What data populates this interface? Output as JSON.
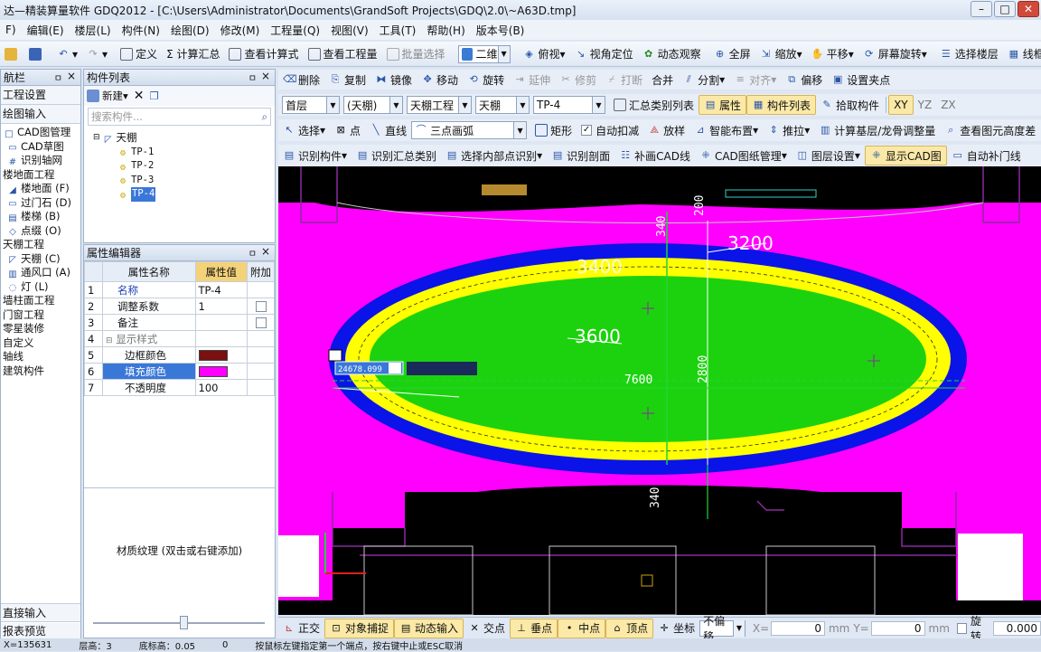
{
  "title": "达—精装算量软件 GDQ2012 - [C:\\Users\\Administrator\\Documents\\GrandSoft Projects\\GDQ\\2.0\\~A63D.tmp]",
  "menu": [
    "F)",
    "编辑(E)",
    "楼层(L)",
    "构件(N)",
    "绘图(D)",
    "修改(M)",
    "工程量(Q)",
    "视图(V)",
    "工具(T)",
    "帮助(H)",
    "版本号(B)"
  ],
  "toolbar1": {
    "define": "定义",
    "sum": "Σ 计算汇总",
    "view_formula": "查看计算式",
    "view_qty": "查看工程量",
    "batch_select": "批量选择",
    "view_2d": "二维",
    "top_view": "俯视",
    "view_locate": "视角定位",
    "dynamic_view": "动态观察",
    "fullscreen": "全屏",
    "zoom": "缩放",
    "pan": "平移",
    "screen_rotate": "屏幕旋转",
    "select_floor": "选择楼层",
    "wireframe": "线框"
  },
  "toolbar2": {
    "delete": "删除",
    "copy": "复制",
    "mirror": "镜像",
    "move": "移动",
    "rotate": "旋转",
    "extend": "延伸",
    "trim": "修剪",
    "break": "打断",
    "merge": "合并",
    "split": "分割",
    "align": "对齐",
    "offset": "偏移",
    "set_point": "设置夹点"
  },
  "toolbar3": {
    "floor": "首层",
    "type": "(天棚)",
    "project": "天棚工程",
    "element": "天棚",
    "component": "TP-4",
    "summary_list": "汇总类别列表",
    "attributes": "属性",
    "component_list": "构件列表",
    "pick": "拾取构件",
    "xy": "XY",
    "yz": "YZ",
    "zx": "ZX"
  },
  "toolbar4": {
    "select": "选择",
    "point": "点",
    "line": "直线",
    "arc": "三点画弧",
    "rect": "矩形",
    "auto_deduct": "自动扣减",
    "place_sample": "放样",
    "smart_place": "智能布置",
    "push_pull": "推拉",
    "calc_base": "计算基层/龙骨调整量",
    "view_height": "查看图元高度差"
  },
  "toolbar5": {
    "identify_component": "识别构件",
    "identify_summary": "识别汇总类别",
    "identify_inner": "选择内部点识别",
    "identify_section": "识别剖面",
    "fill_cad": "补画CAD线",
    "cad_manage": "CAD图纸管理",
    "layer_setting": "图层设置",
    "show_cad": "显示CAD图",
    "auto_door": "自动补门线"
  },
  "nav": {
    "title": "航栏",
    "items": [
      "工程设置",
      "绘图输入",
      "CAD图管理",
      "CAD草图",
      "识别轴网",
      "楼地面工程",
      "楼地面 (F)",
      "过门石 (D)",
      "楼梯 (B)",
      "点缀 (O)",
      "天棚工程",
      "天棚 (C)",
      "通风口 (A)",
      "灯 (L)",
      "墙柱面工程",
      "门窗工程",
      "零星装修",
      "自定义",
      "轴线",
      "建筑构件"
    ],
    "bottom_items": [
      "直接输入",
      "报表预览"
    ]
  },
  "component_list": {
    "title": "构件列表",
    "new_label": "新建",
    "search_placeholder": "搜索构件...",
    "root": "天棚",
    "items": [
      "TP-1",
      "TP-2",
      "TP-3",
      "TP-4"
    ]
  },
  "property_editor": {
    "title": "属性编辑器",
    "headers": [
      "属性名称",
      "属性值",
      "附加"
    ],
    "rows": [
      {
        "no": "1",
        "name": "名称",
        "value": "TP-4"
      },
      {
        "no": "2",
        "name": "调整系数",
        "value": "1"
      },
      {
        "no": "3",
        "name": "备注",
        "value": ""
      },
      {
        "no": "4",
        "name": "显示样式",
        "value": ""
      },
      {
        "no": "5",
        "name": "边框颜色",
        "value": ""
      },
      {
        "no": "6",
        "name": "填充颜色",
        "value": ""
      },
      {
        "no": "7",
        "name": "不透明度",
        "value": "100"
      }
    ],
    "border_color": "#7a1010",
    "fill_color": "#ff00ff",
    "texture_hint": "材质纹理 (双击或右键添加)"
  },
  "canvas": {
    "dims": [
      "200",
      "340",
      "3200",
      "3400",
      "3600",
      "7600",
      "2800",
      "340"
    ],
    "coord_input": "24678.099",
    "colors": {
      "pink": "#ff00ff",
      "blue": "#0a14e8",
      "yellow": "#ffff00",
      "green": "#1cd20e"
    }
  },
  "statusbar": {
    "ortho": "正交",
    "snap": "对象捕捉",
    "dyn_input": "动态输入",
    "intersect": "交点",
    "perp": "垂点",
    "mid": "中点",
    "vertex": "顶点",
    "coord": "坐标",
    "offset_mode": "不偏移",
    "x_label": "X=",
    "x_val": "0",
    "mm1": "mm",
    "y_label": "Y=",
    "y_val": "0",
    "mm2": "mm",
    "rotate": "旋转",
    "rotate_val": "0.000"
  },
  "bottom": {
    "coord_text": "X=135631",
    "floor_height": "层高：3",
    "base_height": "底标高：0.05",
    "zero": "0",
    "hint": "按鼠标左键指定第一个端点，按右键中止或ESC取消"
  }
}
